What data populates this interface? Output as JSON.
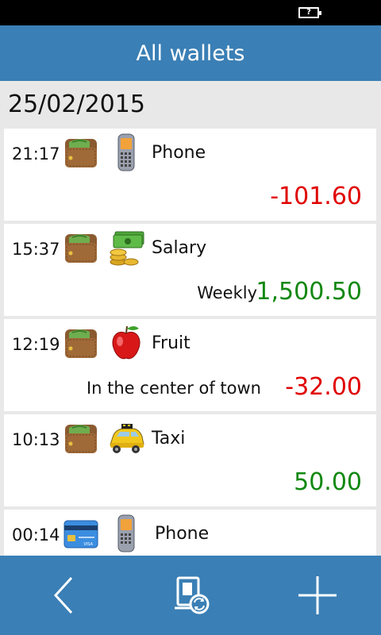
{
  "status_bar": {
    "battery_text": "?"
  },
  "header": {
    "title": "All wallets"
  },
  "date": "25/02/2015",
  "transactions": [
    {
      "time": "21:17",
      "wallet_icon": "wallet-icon",
      "category_icon": "phone-icon",
      "category": "Phone",
      "note": "",
      "amount": "-101.60",
      "amount_color": "#e00000"
    },
    {
      "time": "15:37",
      "wallet_icon": "wallet-icon",
      "category_icon": "money-icon",
      "category": "Salary",
      "note": "Weekly",
      "amount": "1,500.50",
      "amount_color": "#118811"
    },
    {
      "time": "12:19",
      "wallet_icon": "wallet-icon",
      "category_icon": "apple-icon",
      "category": "Fruit",
      "note": "In the center of town",
      "amount": "-32.00",
      "amount_color": "#e00000"
    },
    {
      "time": "10:13",
      "wallet_icon": "wallet-icon",
      "category_icon": "taxi-icon",
      "category": "Taxi",
      "note": "",
      "amount": "50.00",
      "amount_color": "#118811"
    },
    {
      "time": "00:14",
      "wallet_icon": "credit-card-icon",
      "category_icon": "phone-icon",
      "category": "Phone",
      "note": "",
      "amount": "",
      "amount_color": "#e00000"
    }
  ],
  "toolbar": {
    "back_icon": "back-arrow-icon",
    "sync_icon": "sync-icon",
    "add_icon": "plus-icon"
  },
  "colors": {
    "accent": "#3a7fb5",
    "negative": "#e00000",
    "positive": "#118811"
  }
}
